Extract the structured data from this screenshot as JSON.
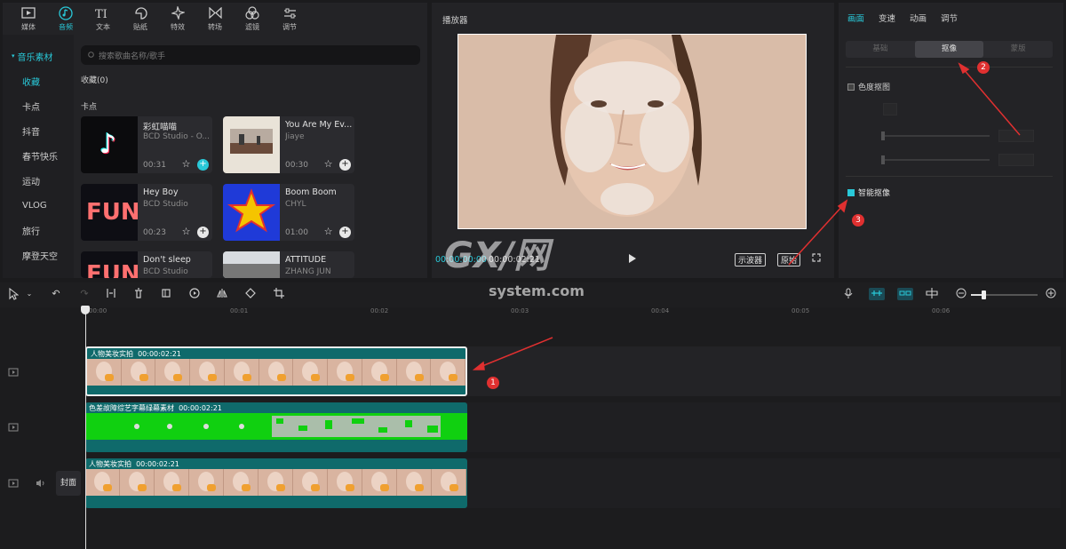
{
  "top_tabs": [
    {
      "label": "媒体",
      "icon": "media-icon"
    },
    {
      "label": "音频",
      "icon": "audio-icon"
    },
    {
      "label": "文本",
      "icon": "text-icon"
    },
    {
      "label": "贴纸",
      "icon": "sticker-icon"
    },
    {
      "label": "特效",
      "icon": "effects-icon"
    },
    {
      "label": "转场",
      "icon": "transition-icon"
    },
    {
      "label": "滤镜",
      "icon": "filter-icon"
    },
    {
      "label": "调节",
      "icon": "adjust-icon"
    }
  ],
  "active_tab": "音频",
  "sidebar": {
    "header": "音乐素材",
    "items": [
      "收藏",
      "卡点",
      "抖音",
      "春节快乐",
      "运动",
      "VLOG",
      "旅行",
      "摩登天空"
    ]
  },
  "search": {
    "placeholder": "搜索歌曲名称/歌手"
  },
  "favorites_label": "收藏(0)",
  "section_label": "卡点",
  "cards": [
    {
      "title": "彩虹喵喵",
      "artist": "BCD Studio - O...",
      "duration": "00:31"
    },
    {
      "title": "You Are My Ev...",
      "artist": "Jiaye",
      "duration": "00:30"
    },
    {
      "title": "Hey Boy",
      "artist": "BCD Studio",
      "duration": "00:23"
    },
    {
      "title": "Boom Boom",
      "artist": "CHYL",
      "duration": "01:00"
    },
    {
      "title": "Don't sleep",
      "artist": "BCD Studio",
      "duration": ""
    },
    {
      "title": "ATTITUDE",
      "artist": "ZHANG JUN",
      "duration": ""
    }
  ],
  "fun_text": "FUN",
  "player": {
    "title": "播放器",
    "current_time": "00:00:00:00",
    "total_time": "00:00:02:21",
    "waveform_btn": "示波器",
    "original_btn": "原始"
  },
  "props": {
    "tabs": [
      "画面",
      "变速",
      "动画",
      "调节"
    ],
    "active_tab": "画面",
    "subtabs": [
      "基础",
      "抠像",
      "蒙版"
    ],
    "active_subtab": "抠像",
    "chroma_key": "色度抠图",
    "smart_key": "智能抠像"
  },
  "ruler_labels": [
    "00:00",
    "00:01",
    "00:02",
    "00:03",
    "00:04",
    "00:05",
    "00:06"
  ],
  "clips": [
    {
      "name": "人物美妆实拍",
      "duration": "00:00:02:21"
    },
    {
      "name": "色差故障综艺字幕绿幕素材",
      "duration": "00:00:02:21"
    },
    {
      "name": "人物美妆实拍",
      "duration": "00:00:02:21"
    }
  ],
  "cover_label": "封面",
  "annotations": [
    "1",
    "2",
    "3"
  ],
  "watermark": {
    "main": "GX/网",
    "sub": "system.com"
  },
  "colors": {
    "accent": "#29c8d8",
    "arrow": "#e03030",
    "green_screen": "#10d010",
    "clip_bg": "#0f6a6b"
  }
}
